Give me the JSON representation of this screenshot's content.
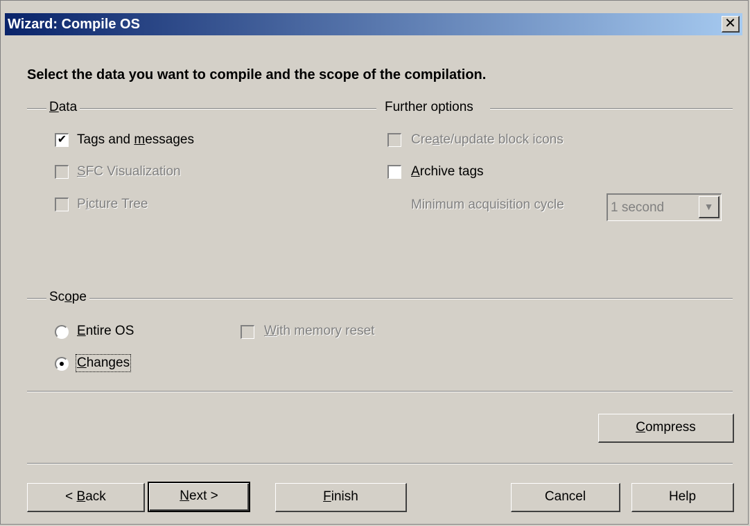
{
  "window": {
    "title": "Wizard: Compile OS",
    "close_glyph": "✕"
  },
  "heading": "Select the data you want to compile and the scope of the compilation.",
  "data_group": {
    "label_pre": "",
    "label_u": "D",
    "label_post": "ata",
    "items": [
      {
        "pre": "Tags and ",
        "u": "m",
        "post": "essages",
        "checked": true,
        "enabled": true
      },
      {
        "pre": "",
        "u": "S",
        "post": "FC Visualization",
        "checked": false,
        "enabled": false
      },
      {
        "pre": "P",
        "u": "i",
        "post": "cture Tree",
        "checked": false,
        "enabled": false
      }
    ]
  },
  "further_group": {
    "label": "Further options",
    "create_icons": {
      "pre": "Cre",
      "u": "a",
      "post": "te/update block icons",
      "checked": false,
      "enabled": false
    },
    "archive_tags": {
      "pre": "",
      "u": "A",
      "post": "rchive tags",
      "checked": false,
      "enabled": true
    },
    "min_cycle_label": "Minimum acquisition cycle",
    "min_cycle_value": "1 second"
  },
  "scope_group": {
    "label_pre": "Sc",
    "label_u": "o",
    "label_post": "pe",
    "entire_os": {
      "pre": "",
      "u": "E",
      "post": "ntire OS",
      "selected": false
    },
    "changes": {
      "pre": "",
      "u": "C",
      "post": "hanges",
      "selected": true
    },
    "memory_reset": {
      "pre": "",
      "u": "W",
      "post": "ith memory reset",
      "checked": false,
      "enabled": false
    }
  },
  "buttons": {
    "compress": {
      "pre": "",
      "u": "C",
      "post": "ompress"
    },
    "back": {
      "pre": "< ",
      "u": "B",
      "post": "ack"
    },
    "next": {
      "pre": "",
      "u": "N",
      "post": "ext >"
    },
    "finish": {
      "pre": "",
      "u": "F",
      "post": "inish"
    },
    "cancel": {
      "pre": "Cancel",
      "u": "",
      "post": ""
    },
    "help": {
      "pre": "Help",
      "u": "",
      "post": ""
    }
  },
  "checkmark_glyph": "✔"
}
